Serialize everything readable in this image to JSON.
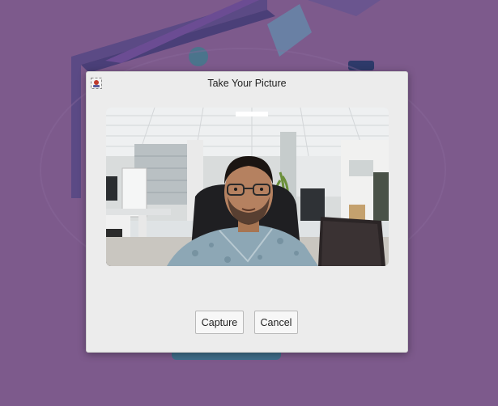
{
  "dialog": {
    "title": "Take Your Picture",
    "icon": "camera-app-icon"
  },
  "preview": {
    "description_icon": "webcam-preview"
  },
  "buttons": {
    "capture_label": "Capture",
    "cancel_label": "Cancel"
  },
  "colors": {
    "wallpaper": "#7d5a8c",
    "dialog_bg": "#ececec",
    "button_bg": "#f7f7f7"
  }
}
